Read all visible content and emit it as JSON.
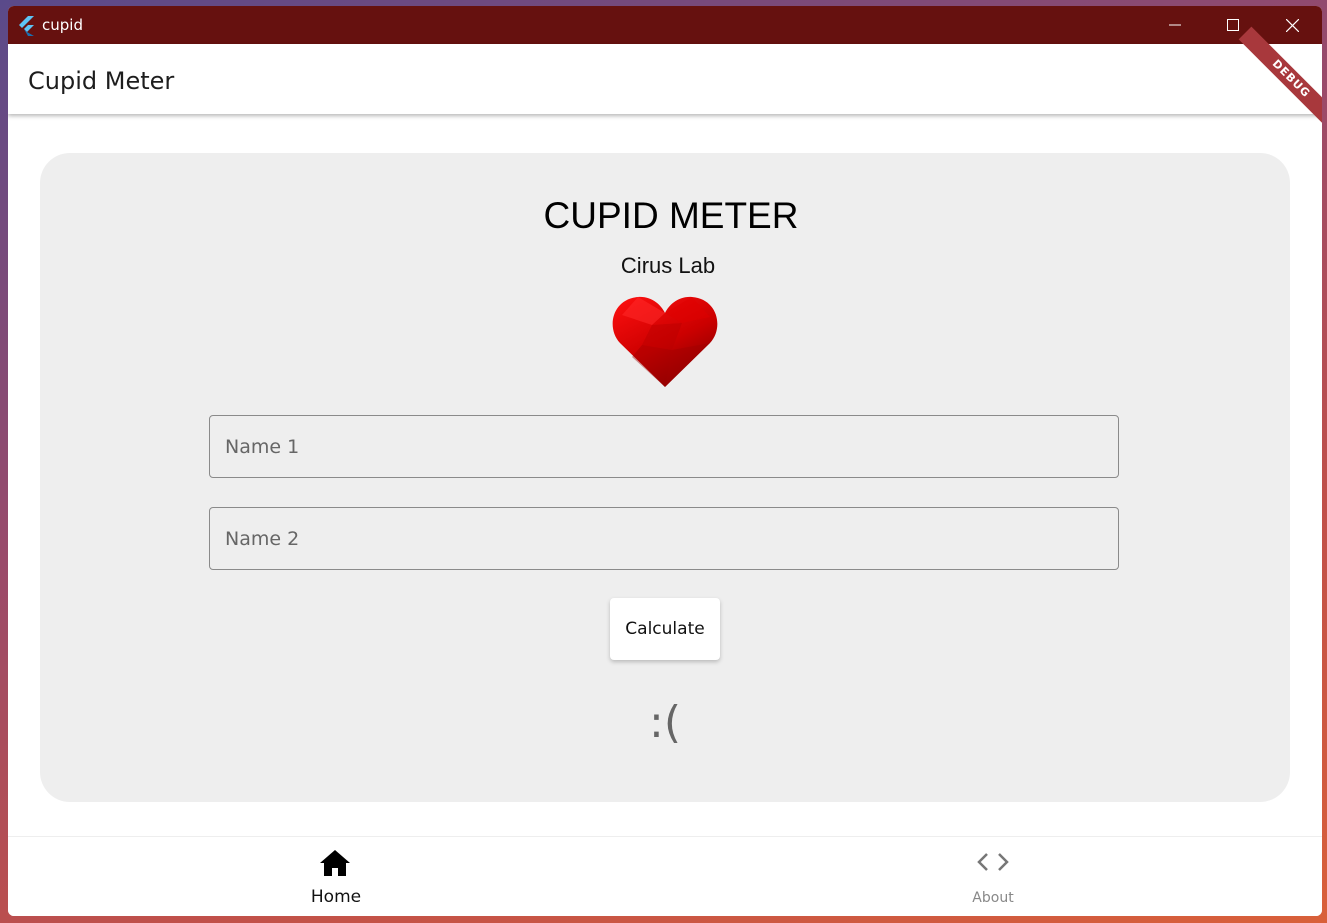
{
  "window": {
    "title": "cupid"
  },
  "appbar": {
    "title": "Cupid Meter",
    "debug_label": "DEBUG"
  },
  "card": {
    "title": "CUPID METER",
    "subtitle": "Cirus Lab",
    "name1_placeholder": "Name 1",
    "name1_value": "",
    "name2_placeholder": "Name 2",
    "name2_value": "",
    "calculate_label": "Calculate",
    "result": ":("
  },
  "nav": {
    "items": [
      {
        "label": "Home",
        "icon": "home-icon",
        "selected": true
      },
      {
        "label": "About",
        "icon": "code-icon",
        "selected": false
      }
    ]
  },
  "colors": {
    "titlebar": "#66110f",
    "card_bg": "#eeeeee",
    "heart": "#d00000",
    "debug_ribbon": "#a8383c"
  }
}
